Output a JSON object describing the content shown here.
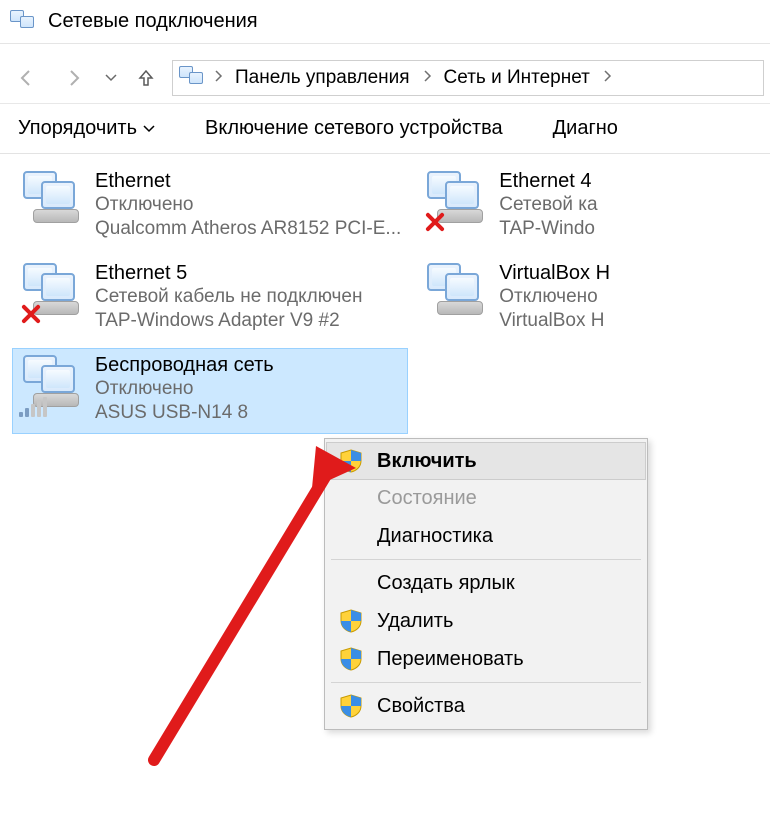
{
  "window": {
    "title": "Сетевые подключения"
  },
  "breadcrumbs": {
    "0": "Панель управления",
    "1": "Сеть и Интернет"
  },
  "toolbar": {
    "organize": "Упорядочить",
    "enable_device": "Включение сетевого устройства",
    "diagnose": "Диагно"
  },
  "connections": {
    "0": {
      "name": "Ethernet",
      "status": "Отключено",
      "device": "Qualcomm Atheros AR8152 PCI-E..."
    },
    "1": {
      "name": "Ethernet 4",
      "status": "Сетевой ка",
      "device": "TAP-Windo"
    },
    "2": {
      "name": "Ethernet 5",
      "status": "Сетевой кабель не подключен",
      "device": "TAP-Windows Adapter V9 #2"
    },
    "3": {
      "name": "VirtualBox H",
      "status": "Отключено",
      "device": "VirtualBox H"
    },
    "4": {
      "name": "Беспроводная сеть",
      "status": "Отключено",
      "device": "ASUS USB-N14 8"
    }
  },
  "context_menu": {
    "enable": "Включить",
    "status": "Состояние",
    "diag": "Диагностика",
    "create_shortcut": "Создать ярлык",
    "delete": "Удалить",
    "rename": "Переименовать",
    "properties": "Свойства"
  }
}
